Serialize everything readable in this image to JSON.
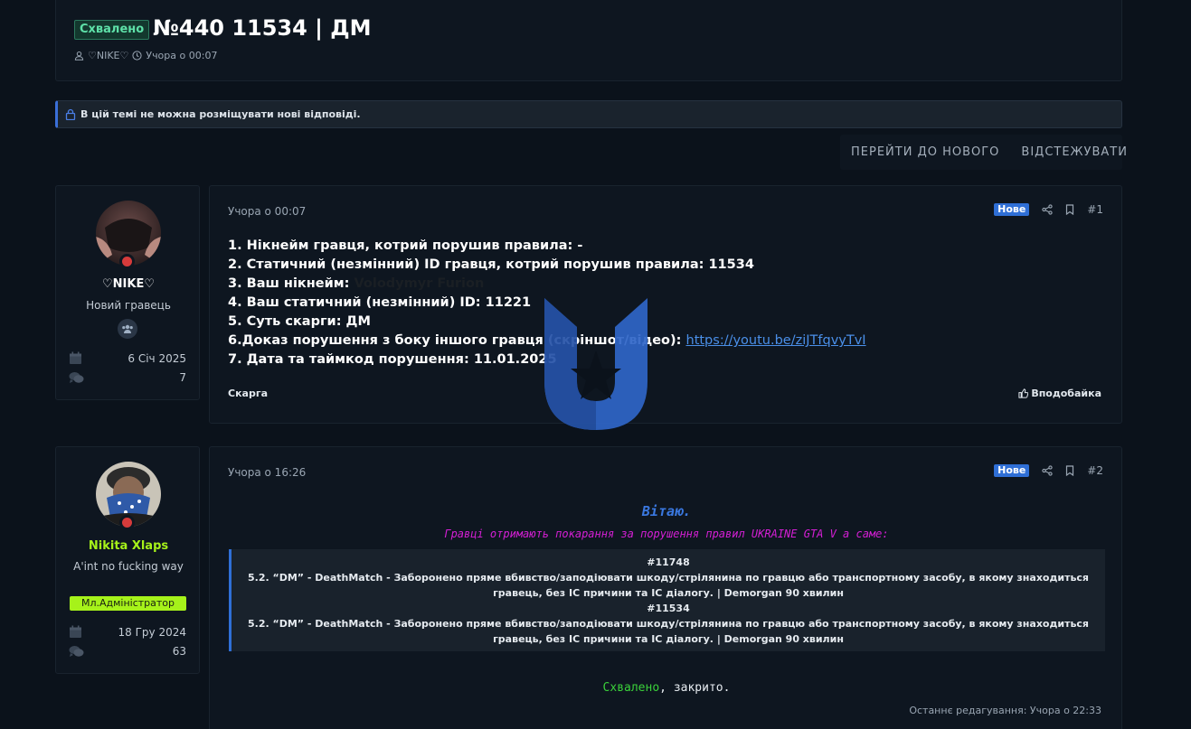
{
  "thread": {
    "status_badge": "Схвалено",
    "title": "№440 11534 | ДМ",
    "author": "♡NIKE♡",
    "time": "Учора о 00:07",
    "notice": "В цій темі не можна розміщувати нові відповіді.",
    "actions": {
      "goto_new": "ПЕРЕЙТИ ДО НОВОГО",
      "watch": "ВІДСТЕЖУВАТИ"
    }
  },
  "posts": [
    {
      "user": {
        "name": "♡NIKE♡",
        "title": "Новий гравець",
        "joined": "6 Січ 2025",
        "messages": "7",
        "name_color": "#ffffff"
      },
      "date": "Учора о 00:07",
      "new_badge": "Нове",
      "number": "#1",
      "lines": {
        "l1": "1. Нікнейм гравця, котрий порушив правила: -",
        "l2": "2. Статичний (незмінний) ID гравця, котрий порушив правила: 11534",
        "l3_label": "3. Ваш нікнейм: ",
        "l3_value": "Volodymyr Furion",
        "l4": "4. Ваш статичний (незмінний) ID: 11221",
        "l5": "5. Суть скарги: ДМ",
        "l6_label": "6.Доказ порушення з боку іншого гравця (скріншот/відео): ",
        "l6_link": "https://youtu.be/ziJTfqvyTvI",
        "l7": "7. Дата та таймкод порушення: 11.01.2025"
      },
      "tag": "Скарга",
      "like": "Вподобайка"
    },
    {
      "user": {
        "name": "Nikita Xlaps",
        "title": "A'int no fucking way",
        "role": "Мл.Адміністратор",
        "joined": "18 Гру 2024",
        "messages": "63",
        "name_color": "#a6f21a"
      },
      "date": "Учора о 16:26",
      "new_badge": "Нове",
      "number": "#2",
      "greeting": "Вітаю.",
      "subtitle": "Гравці отримають покарання за порушення правил UKRAINE GTA V а саме:",
      "quote": {
        "id1": "#11748",
        "rule1a": "5.2. “DM” - DeathMatch - Заборонено пряме вбивство/заподіювати шкоду/стрілянина по гравцю або транспортному засобу, в якому знаходиться",
        "rule1b": "гравець, без IC причини та IC діалогу. | Demorgan 90 хвилин",
        "id2": "#11534",
        "rule2a": "5.2. “DM” - DeathMatch - Заборонено пряме вбивство/заподіювати шкоду/стрілянина по гравцю або транспортному засобу, в якому знаходиться",
        "rule2b": "гравець, без IC причини та IC діалогу. | Demorgan 90 хвилин"
      },
      "approved_word": "Схвалено",
      "closed_text": ", закрито.",
      "edited": "Останнє редагування: Учора о 22:33"
    }
  ],
  "colors": {
    "accent": "#2f6fd6",
    "approved": "#3ad13a",
    "greeting": "#3a78e0",
    "subtitle": "#d51fd5",
    "role_bg": "#a6f21a"
  }
}
